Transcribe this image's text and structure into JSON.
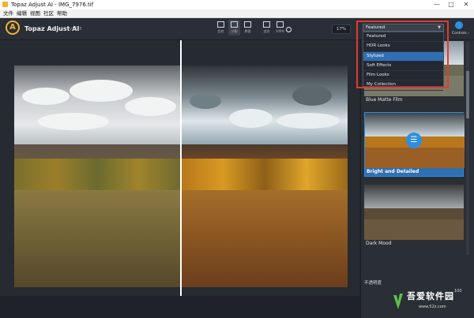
{
  "window": {
    "title": "Topaz Adjust AI - IMG_7976.tif",
    "controls": [
      "—",
      "□",
      "✕"
    ]
  },
  "menubar": {
    "items": [
      "文件",
      "编辑",
      "视图",
      "社区",
      "帮助"
    ]
  },
  "toolbar": {
    "logo_letter": "A",
    "app_name": "Topaz Adjust AI",
    "version": "v1.0.5",
    "view_buttons": [
      {
        "label": "比较",
        "icon": "compare-icon"
      },
      {
        "label": "分割",
        "icon": "split-view-icon",
        "active": true
      },
      {
        "label": "原图",
        "icon": "original-icon"
      }
    ],
    "zoom_buttons": [
      {
        "label": "适合",
        "icon": "fit-icon"
      },
      {
        "label": "100%",
        "icon": "zoom-100-icon"
      }
    ],
    "zoom_value": "17%",
    "controls_label": "Controls ›"
  },
  "presets": {
    "selected": "Featured",
    "options": [
      "Featured",
      "HDR Looks",
      "Stylized",
      "Soft Effects",
      "Film Looks",
      "My Collection"
    ],
    "highlighted": "Stylized"
  },
  "thumbnails": [
    {
      "label": "Blue Matte Film"
    },
    {
      "label": "Bright and Detailed",
      "active": true
    },
    {
      "label": "Dark Mood"
    }
  ],
  "panel": {
    "opacity_label": "不透明度",
    "opacity_value": "100"
  },
  "watermark": {
    "text": "吾爱软件园",
    "url": "www.52z.com"
  },
  "colors": {
    "accent": "#2d8fe0",
    "logo": "#f2b233",
    "highlight_box": "#e33b2e"
  }
}
